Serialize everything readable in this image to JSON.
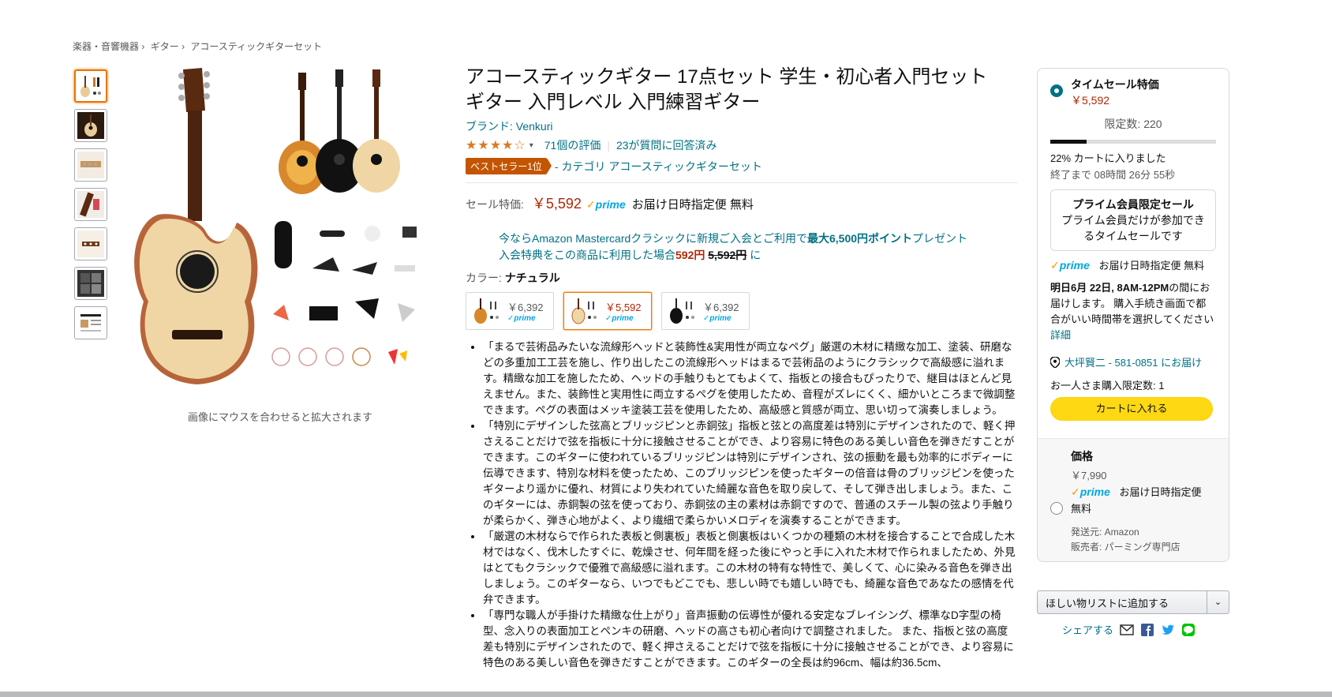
{
  "breadcrumb": [
    "楽器・音響機器",
    "ギター",
    "アコースティックギターセット"
  ],
  "breadcrumb_sep": "›",
  "gallery": {
    "thumbnail_icons": [
      "guitar-set-thumb",
      "guitar-front-thumb",
      "headstock-thumb",
      "fretboard-thumb",
      "bridge-thumb",
      "accessories-thumb",
      "info-thumb"
    ],
    "hover_hint": "画像にマウスを合わせると拡大されます"
  },
  "product": {
    "title": "アコースティックギター 17点セット 学生・初心者入門セット ギター 入門レベル 入門練習ギター",
    "brand": "ブランド: Venkuri",
    "stars": "★★★★☆",
    "rating_count": "71個の評価",
    "qa_count": "23が質問に回答済み",
    "bestseller_badge": "ベストセラー1位",
    "bestseller_category": "- カテゴリ アコースティックギターセット",
    "price_label": "セール特価:",
    "price": "￥5,592",
    "prime_label": "prime",
    "delivery": "お届け日時指定便 無料",
    "promo_line1_prefix": "今ならAmazon Mastercardクラシックに新規ご入会とご利用で",
    "promo_line1_bold": "最大6,500円ポイント",
    "promo_line1_suffix": "プレゼント",
    "promo_line2_prefix": "入会特典をこの商品に利用した場合",
    "promo_line2_price": "592円",
    "promo_line2_strike": "5,592円",
    "promo_line2_suffix": "に",
    "color_label": "カラー:",
    "color_value": "ナチュラル",
    "swatches": [
      {
        "price": "￥6,392",
        "prime": "✓prime",
        "color": "sunburst"
      },
      {
        "price": "￥5,592",
        "prime": "✓prime",
        "color": "natural"
      },
      {
        "price": "￥6,392",
        "prime": "✓prime",
        "color": "black"
      }
    ],
    "bullets": [
      "「まるで芸術品みたいな流線形ヘッドと装飾性&実用性が両立なペグ」厳選の木材に精緻な加工、塗装、研磨などの多重加工工芸を施し、作り出したこの流線形ヘッドはまるで芸術品のようにクラシックで高級感に溢れます。精緻な加工を施したため、ヘッドの手触りもとてもよくて、指板との接合もぴったりで、継目はほとんど見えません。また、装飾性と実用性に両立するペグを使用したため、音程がズレにくく、細かいところまで微調整できます。ペグの表面はメッキ塗装工芸を使用したため、高級感と質感が両立、思い切って演奏しましょう。",
      "「特別にデザインした弦高とブリッジピンと赤銅弦」指板と弦との高度差は特別にデザインされたので、軽く押さえることだけで弦を指板に十分に接触させることができ、より容易に特色のある美しい音色を弾きだすことができます。このギターに使われているブリッジピンは特別にデザインされ、弦の振動を最も効率的にボディーに伝導できます、特別な材料を使ったため、このブリッジピンを使ったギターの倍音は骨のブリッジピンを使ったギターより遥かに優れ、材質により失われていた綺麗な音色を取り戻して、そして弾き出しましょう。また、このギターには、赤銅製の弦を使っており、赤銅弦の主の素材は赤銅ですので、普通のスチール製の弦より手触りが柔らかく、弾き心地がよく、より繊細で柔らかいメロディを演奏することができます。",
      "「厳選の木材ならで作られた表板と側裏板」表板と側裏板はいくつかの種類の木材を接合することで合成した木材ではなく、伐木したすぐに、乾燥させ、何年間を経った後にやっと手に入れた木材で作られましたため、外見はとてもクラシックで優雅で高級感に溢れます。この木材の特有な特性で、美しくて、心に染みる音色を弾き出しましょう。このギターなら、いつでもどこでも、悲しい時でも嬉しい時でも、綺麗な音色であなたの感情を代弁できます。",
      "「専門な職人が手掛けた精緻な仕上がり」音声振動の伝導性が優れる安定なブレイシング、標準なD字型の椅型、念入りの表面加工とペンキの研磨、ヘッドの高さも初心者向けで調整されました。 また、指板と弦の高度差も特別にデザインされたので、軽く押さえることだけで弦を指板に十分に接触させることができ、より容易に特色のある美しい音色を弾きだすことができます。このギターの全長は約96cm、幅は約36.5cm、"
    ]
  },
  "buybox": {
    "deal_title": "タイムセール特価",
    "deal_price": "￥5,592",
    "limited": "限定数: 220",
    "progress_fraction": 0.22,
    "claimed": "22% カートに入りました",
    "timer": "終了まで 08時間 26分 55秒",
    "prime_box_title": "プライム会員限定セール",
    "prime_box_text": "プライム会員だけが参加できるタイムセールです",
    "prime_label": "prime",
    "delivery": "お届け日時指定便 無料",
    "date_prefix": "明日6月 22日, 8AM-12PM",
    "date_suffix": "の間にお届けします。 購入手続き画面で都合がいい時間帯を選択してください",
    "details_link": "詳細",
    "location": "大坪賢二 - 581-0851 にお届け",
    "per_person": "お一人さま購入限定数: 1",
    "cart_button": "カートに入れる",
    "alt_label": "価格",
    "alt_price": "￥7,990",
    "alt_delivery": "お届け日時指定便",
    "alt_free": "無料",
    "ships_from": "発送元: Amazon",
    "sold_by": "販売者: パーミング専門店"
  },
  "wishlist": {
    "label": "ほしい物リストに追加する",
    "arrow": "⌄"
  },
  "share": {
    "label": "シェアする"
  },
  "colors": {
    "link": "#007185",
    "price": "#b12704",
    "prime": "#00a8e1",
    "cart": "#ffd814",
    "badge": "#c45500"
  }
}
